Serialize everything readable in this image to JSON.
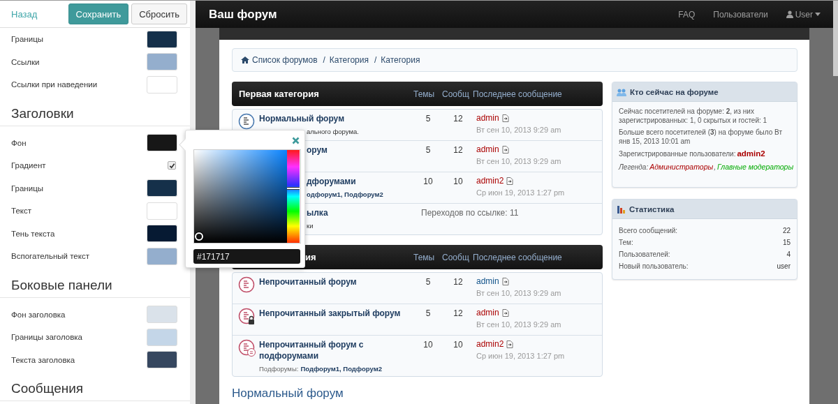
{
  "settings_panel": {
    "back_link": "Назад",
    "buttons": [
      {
        "label": "Сохранить",
        "kind": "primary"
      },
      {
        "label": "Сбросить",
        "kind": "default"
      }
    ],
    "sections": [
      {
        "rows": [
          {
            "label": "Границы",
            "kind": "color",
            "color": "#15304a"
          },
          {
            "label": "Ссылки",
            "kind": "color",
            "color": "#94aecd"
          },
          {
            "label": "Ссылки при наведении",
            "kind": "color",
            "color": "#ffffff"
          }
        ]
      },
      {
        "heading": "Заголовки",
        "rows": [
          {
            "label": "Фон",
            "kind": "color",
            "color": "#171717"
          },
          {
            "label": "Градиент",
            "kind": "checkbox",
            "checked": true
          },
          {
            "label": "Границы",
            "kind": "color",
            "color": "#15304a"
          },
          {
            "label": "Текст",
            "kind": "color",
            "color": "#ffffff"
          },
          {
            "label": "Тень текста",
            "kind": "color",
            "color": "#061a33"
          },
          {
            "label": "Вспогательный текст",
            "kind": "color",
            "color": "#94aecd"
          }
        ]
      },
      {
        "heading": "Боковые панели",
        "rows": [
          {
            "label": "Фон заголовка",
            "kind": "color",
            "color": "#dae2ea"
          },
          {
            "label": "Границы заголовка",
            "kind": "color",
            "color": "#c4d6e8"
          },
          {
            "label": "Текста заголовка",
            "kind": "color",
            "color": "#36475f"
          }
        ]
      },
      {
        "heading": "Сообщения"
      }
    ]
  },
  "color_picker": {
    "value": "#171717",
    "hue": {
      "level": 0.59
    }
  },
  "navbar": {
    "brand": "Ваш форум",
    "links": [
      "FAQ",
      "Пользователи"
    ],
    "user": "User"
  },
  "breadcrumbs": [
    {
      "label": "Список форумов"
    },
    {
      "separator": "/",
      "label": "Категория"
    },
    {
      "separator": "/",
      "label": "Категория"
    }
  ],
  "categories": [
    {
      "title": "Первая категория",
      "covered": false,
      "columns": [
        "Темы",
        "Сообщ",
        "Последнее сообщение"
      ],
      "forums": [
        {
          "kind": "read",
          "title": "Нормальный форум",
          "description": "ального форума.",
          "title_covered": false,
          "details_covered": true,
          "topics": "5",
          "posts": "12",
          "author": {
            "name": "admin",
            "color": "#aa0000"
          },
          "date": "Вт сен 10, 2013 9:29 am"
        },
        {
          "kind": "read",
          "title": "орум",
          "title_covered": true,
          "topics": "5",
          "posts": "12",
          "author": {
            "name": "admin",
            "color": "#aa0000"
          },
          "date": "Вт сен 10, 2013 9:29 am"
        },
        {
          "kind": "read",
          "title": "дфорумами",
          "subforums": "одфорум1, Подфорум2",
          "title_covered": true,
          "details_covered": true,
          "topics": "10",
          "posts": "10",
          "author": {
            "name": "admin2",
            "color": "#aa0000"
          },
          "date": "Ср июн 19, 2013 1:27 pm"
        },
        {
          "kind": "link",
          "title": "ылка",
          "description": "ки",
          "title_covered": true,
          "details_covered": true,
          "redirects": "Переходов по ссылке: 11"
        }
      ]
    },
    {
      "title": "ия",
      "covered": true,
      "columns": [
        "Темы",
        "Сообщ",
        "Последнее сообщение"
      ],
      "forums": [
        {
          "kind": "unread",
          "title": "Непрочитанный форум",
          "title_covered": false,
          "topics": "5",
          "posts": "12",
          "author": {
            "name": "admin",
            "color": "#105289"
          },
          "date": "Вт сен 10, 2013 9:29 am"
        },
        {
          "kind": "unread_locked",
          "title": "Непрочитанный закрытый форум",
          "title_covered": false,
          "topics": "5",
          "posts": "12",
          "author": {
            "name": "admin",
            "color": "#aa0000"
          },
          "date": "Вт сен 10, 2013 9:29 am"
        },
        {
          "kind": "unread_subforums",
          "title": "Непрочитанный форум с подфорумами",
          "title_covered": false,
          "details_covered": false,
          "subforums_label": "Подфорумы:",
          "subforums": "Подфорум1, Подфорум2",
          "topics": "10",
          "posts": "10",
          "author": {
            "name": "admin2",
            "color": "#aa0000"
          },
          "date": "Ср июн 19, 2013 1:27 pm"
        }
      ]
    }
  ],
  "page_heading": "Нормальный форум",
  "online_panel": {
    "title": "Кто сейчас на форуме",
    "lines": [
      "Сейчас посетителей на форуме: **2**, из них зарегистрированных: 1, 0 скрытых и гостей: 1",
      "Больше всего посетителей (**3**) на форуме было Вт янв 15, 2013 10:01 am"
    ],
    "registered_label": "Зарегистрированные пользователи:",
    "registered": [
      {
        "name": "admin2",
        "color": "#aa0000"
      }
    ],
    "legend_label": "Легенда:",
    "legend_separator": ",",
    "legend": [
      {
        "name": "Администраторы",
        "color": "#aa0000"
      },
      {
        "name": "Главные модераторы",
        "color": "#00aa00"
      }
    ]
  },
  "stats_panel": {
    "title": "Статистика",
    "rows": [
      {
        "label": "Всего сообщений:",
        "value": "22"
      },
      {
        "label": "Тем:",
        "value": "15"
      },
      {
        "label": "Пользователей:",
        "value": "4"
      },
      {
        "label": "Новый пользователь:",
        "value": "user"
      }
    ]
  }
}
